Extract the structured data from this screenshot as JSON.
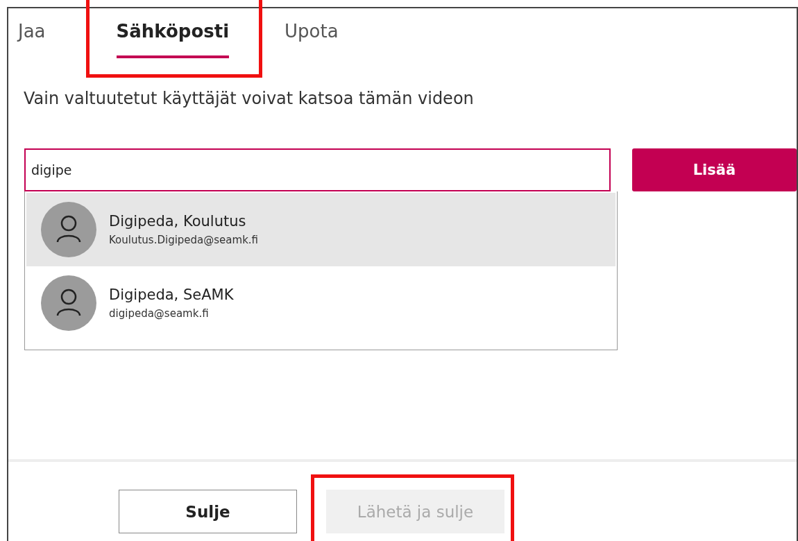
{
  "tabs": [
    {
      "label": "Jaa",
      "selected": false,
      "highlighted": false
    },
    {
      "label": "Sähköposti",
      "selected": true,
      "highlighted": true
    },
    {
      "label": "Upota",
      "selected": false,
      "highlighted": false
    }
  ],
  "notice": "Vain valtuutetut käyttäjät voivat katsoa tämän videon",
  "recipient_field": {
    "value": "digipe"
  },
  "add_button": "Lisää",
  "suggestions": [
    {
      "name": "Digipeda, Koulutus",
      "email": "Koulutus.Digipeda@seamk.fi",
      "selected": true
    },
    {
      "name": "Digipeda, SeAMK",
      "email": "digipeda@seamk.fi",
      "selected": false
    }
  ],
  "buttons": [
    {
      "label": "Sulje",
      "disabled": false,
      "highlighted": false
    },
    {
      "label": "Lähetä ja sulje",
      "disabled": true,
      "highlighted": true
    }
  ]
}
